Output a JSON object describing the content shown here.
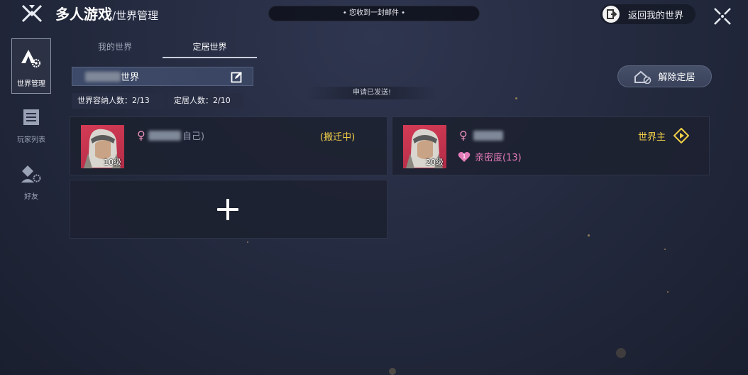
{
  "header": {
    "title": "多人游戏",
    "subtitle": "/世界管理",
    "notice": "• 您收到一封邮件 •",
    "return_label": "返回我的世界"
  },
  "sidebar": {
    "items": [
      {
        "label": "世界管理",
        "icon": "tent-gear-icon",
        "active": true
      },
      {
        "label": "玩家列表",
        "icon": "list-icon",
        "active": false
      },
      {
        "label": "好友",
        "icon": "user-gear-icon",
        "active": false
      }
    ]
  },
  "tabs": [
    {
      "label": "我的世界",
      "active": false
    },
    {
      "label": "定居世界",
      "active": true
    }
  ],
  "world": {
    "name_suffix": "世界",
    "disband_label": "解除定居",
    "status_note": "申请已发送!",
    "capacity_label": "世界容纳人数：2/13",
    "settled_label": "定居人数：2/10"
  },
  "players": [
    {
      "level_label": "10级",
      "name_suffix": "自己)",
      "gender_icon": "female-icon",
      "status": "(搬迁中)"
    },
    {
      "level_label": "20级",
      "gender_icon": "female-icon",
      "role": "世界主",
      "intimacy_level": "1",
      "intimacy": "亲密度(13)"
    }
  ],
  "colors": {
    "accent_gold": "#f1cf47",
    "pink": "#e47bb9",
    "avatar_bg": "#d43b55"
  }
}
